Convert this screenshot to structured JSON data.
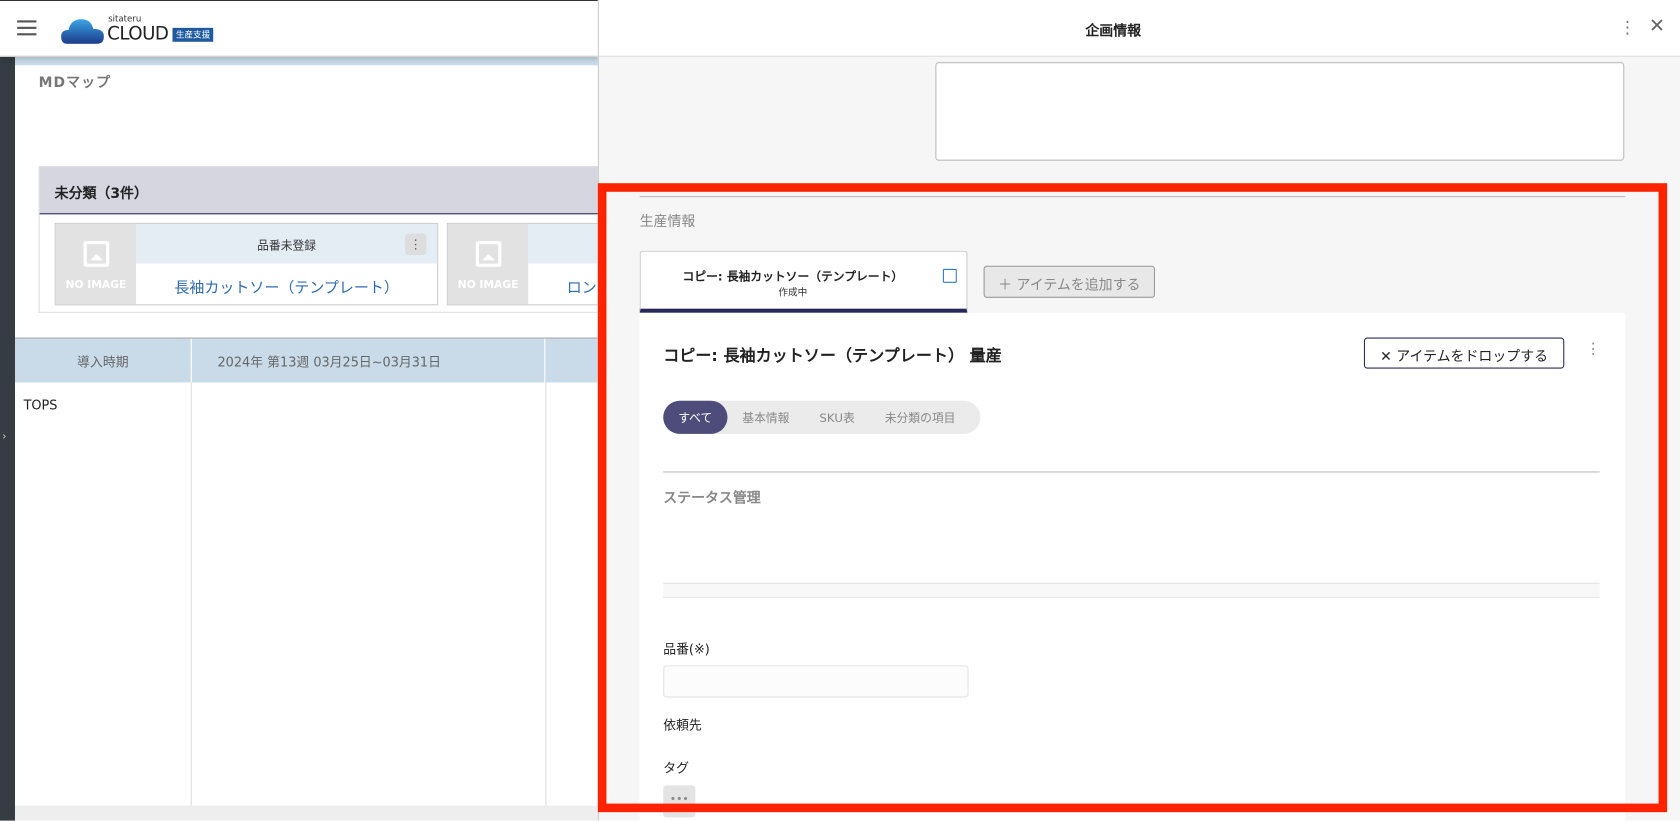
{
  "header": {
    "logo_small": "sitateru",
    "logo_big": "CLOUD",
    "logo_badge": "生産支援"
  },
  "left": {
    "page_title": "MDマップ",
    "group_title": "未分類（3件）",
    "cards": [
      {
        "head": "品番未登録",
        "name": "長袖カットソー（テンプレート）",
        "no_image": "NO IMAGE"
      },
      {
        "head": "",
        "name": "ロン",
        "no_image": "NO IMAGE"
      }
    ],
    "table": {
      "headers": [
        "導入時期",
        "2024年 第13週 03月25日~03月31日"
      ],
      "rows": [
        [
          "TOPS"
        ]
      ]
    }
  },
  "panel": {
    "title": "企画情報",
    "section_label": "生産情報",
    "item_tab": {
      "name": "コピー: 長袖カットソー（テンプレート）",
      "status": "作成中"
    },
    "add_item": "＋ アイテムを追加する",
    "content_title": "コピー: 長袖カットソー（テンプレート） 量産",
    "drop_item": "✕ アイテムをドロップする",
    "filters": [
      "すべて",
      "基本情報",
      "SKU表",
      "未分類の項目"
    ],
    "status_section": "ステータス管理",
    "fields": {
      "hinban_label": "品番(※)",
      "hinban_value": "",
      "requester_label": "依頼先",
      "tag_label": "タグ"
    }
  },
  "colors": {
    "highlight": "#ff2200",
    "accent": "#262858",
    "link": "#2f6bb0"
  }
}
